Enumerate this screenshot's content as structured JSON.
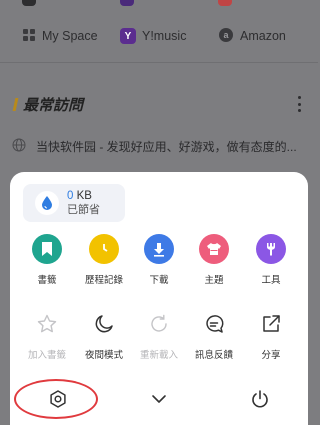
{
  "shortcuts": [
    {
      "label": "My Space",
      "icon": "grid-icon"
    },
    {
      "label": "Y!music",
      "icon": "y-logo",
      "badge": "Y"
    },
    {
      "label": "Amazon",
      "icon": "amazon-logo"
    }
  ],
  "favorites": {
    "title": "最常訪問",
    "items": [
      {
        "label": "当快软件园 - 发现好应用、好游戏，做有态度的..."
      }
    ]
  },
  "menu": {
    "storage": {
      "value": "0",
      "unit": " KB",
      "label": "已節省"
    },
    "row1": [
      {
        "label": "書籤",
        "icon": "bookmark-icon",
        "color": "#1fa58f"
      },
      {
        "label": "歷程記錄",
        "icon": "clock-icon",
        "color": "#f2c200"
      },
      {
        "label": "下載",
        "icon": "download-icon",
        "color": "#3e7ae6"
      },
      {
        "label": "主題",
        "icon": "shirt-icon",
        "color": "#ee5d7c"
      },
      {
        "label": "工具",
        "icon": "wrench-icon",
        "color": "#8b57e5"
      }
    ],
    "row2": [
      {
        "label": "加入書籤",
        "icon": "star-icon",
        "disabled": true
      },
      {
        "label": "夜間模式",
        "icon": "moon-icon",
        "disabled": false
      },
      {
        "label": "重新載入",
        "icon": "reload-icon",
        "disabled": true
      },
      {
        "label": "訊息反饋",
        "icon": "feedback-icon",
        "disabled": false
      },
      {
        "label": "分享",
        "icon": "share-icon",
        "disabled": false
      }
    ],
    "bottom": [
      {
        "icon": "settings-icon"
      },
      {
        "icon": "chevron-down-icon"
      },
      {
        "icon": "power-icon"
      }
    ]
  },
  "colors": {
    "accent": "#2f7de1",
    "highlight": "#e03a3e",
    "overlay": "#7d7d80"
  }
}
